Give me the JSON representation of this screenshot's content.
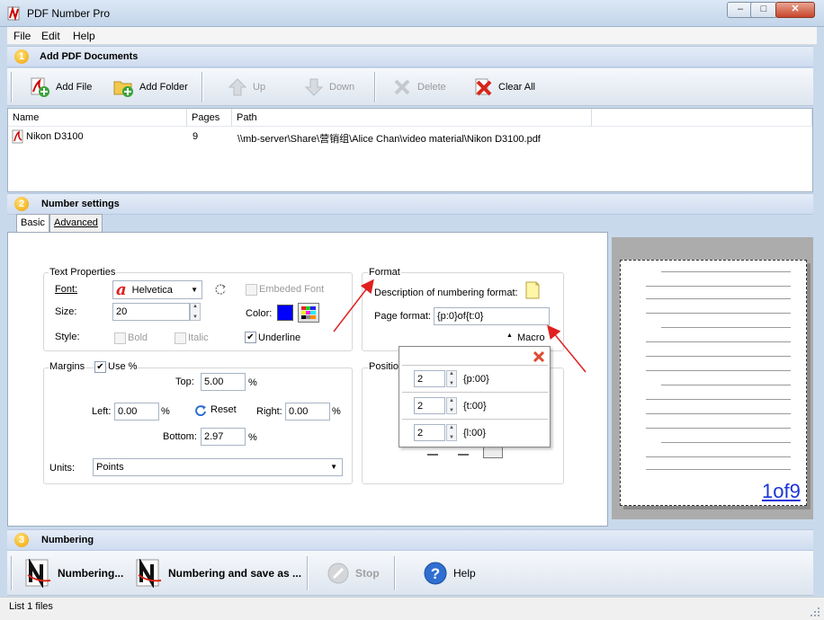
{
  "window": {
    "title": "PDF Number Pro",
    "min": "‒",
    "max": "□",
    "close": "✕"
  },
  "menu": [
    "File",
    "Edit",
    "Help"
  ],
  "sections": {
    "add": {
      "num": "1",
      "label": "Add PDF Documents"
    },
    "settings": {
      "num": "2",
      "label": "Number settings"
    },
    "numbering": {
      "num": "3",
      "label": "Numbering"
    }
  },
  "toolbar": {
    "add_file": "Add File",
    "add_folder": "Add Folder",
    "up": "Up",
    "down": "Down",
    "delete": "Delete",
    "clear_all": "Clear All"
  },
  "filelist": {
    "columns": [
      "Name",
      "Pages",
      "Path"
    ],
    "rows": [
      {
        "name": "Nikon D3100",
        "pages": "9",
        "path": "\\\\mb-server\\Share\\营销组\\Alice Chan\\video material\\Nikon D3100.pdf"
      }
    ]
  },
  "tabs": [
    "Basic",
    "Advanced"
  ],
  "text_props": {
    "group": "Text Properties",
    "font_label": "Font:",
    "font_value": "Helvetica",
    "embed_font": "Embeded Font",
    "size_label": "Size:",
    "size_value": "20",
    "color_label": "Color:",
    "color_value": "#0000ff",
    "style_label": "Style:",
    "bold": "Bold",
    "italic": "Italic",
    "underline": "Underline"
  },
  "format": {
    "group": "Format",
    "desc_label": "Description of numbering format:",
    "page_format_label": "Page format:",
    "page_format_value": "{p:0}of{t:0}",
    "macro": "Macro"
  },
  "margins": {
    "group": "Margins",
    "use_pct": "Use %",
    "top_label": "Top:",
    "top_value": "5.00",
    "left_label": "Left:",
    "left_value": "0.00",
    "reset": "Reset",
    "right_label": "Right:",
    "right_value": "0.00",
    "bottom_label": "Bottom:",
    "bottom_value": "2.97",
    "pct": "%",
    "units_label": "Units:",
    "units_value": "Points"
  },
  "position": {
    "group": "Position"
  },
  "macro_popup": {
    "rows": [
      {
        "value": "2",
        "code": "{p:00}"
      },
      {
        "value": "2",
        "code": "{t:00}"
      },
      {
        "value": "2",
        "code": "{l:00}"
      }
    ]
  },
  "preview": {
    "number_text": "1of9"
  },
  "bottom_toolbar": {
    "numbering": "Numbering...",
    "numbering_save": "Numbering and save as ...",
    "stop": "Stop",
    "help": "Help"
  },
  "status": "List 1 files"
}
